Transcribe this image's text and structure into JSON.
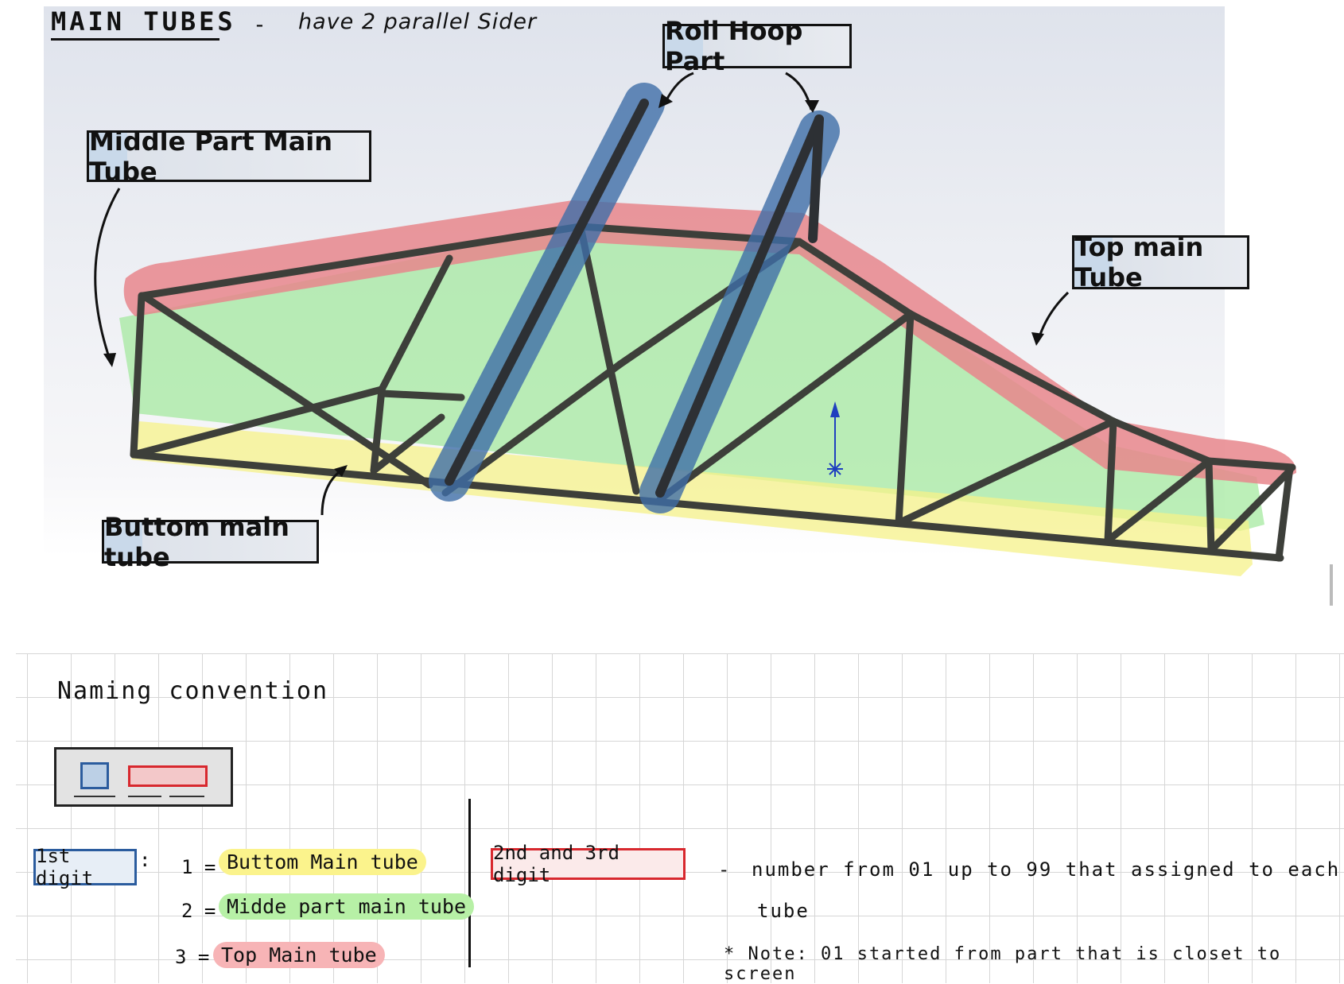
{
  "header": {
    "title": "MAIN TUBES",
    "dash": "-",
    "subtitle": "have 2 parallel Sider"
  },
  "labels": {
    "roll_hoop": "Roll Hoop Part",
    "middle_part": "Middle Part Main Tube",
    "top_main": "Top main Tube",
    "bottom_main": "Buttom main tube"
  },
  "colors": {
    "top_highlight": "#e8868c",
    "middle_highlight": "#9fe89a",
    "bottom_highlight": "#f5f28a",
    "roll_hoop_highlight": "#3f6ea8",
    "tube": "#3d3f3a"
  },
  "naming": {
    "heading": "Naming convention",
    "first_digit_label": "1st digit",
    "colon": ":",
    "items": [
      {
        "num": "1 =",
        "text": "Buttom Main tube"
      },
      {
        "num": "2 =",
        "text": "Midde part main tube"
      },
      {
        "num": "3 =",
        "text": "Top Main tube"
      }
    ],
    "second_third_label": "2nd and 3rd digit",
    "desc_dash": "-",
    "desc_line1": "number from 01 up to 99 that assigned to each",
    "desc_line2": "tube",
    "note": "* Note: 01 started from part that is closet to screen"
  }
}
